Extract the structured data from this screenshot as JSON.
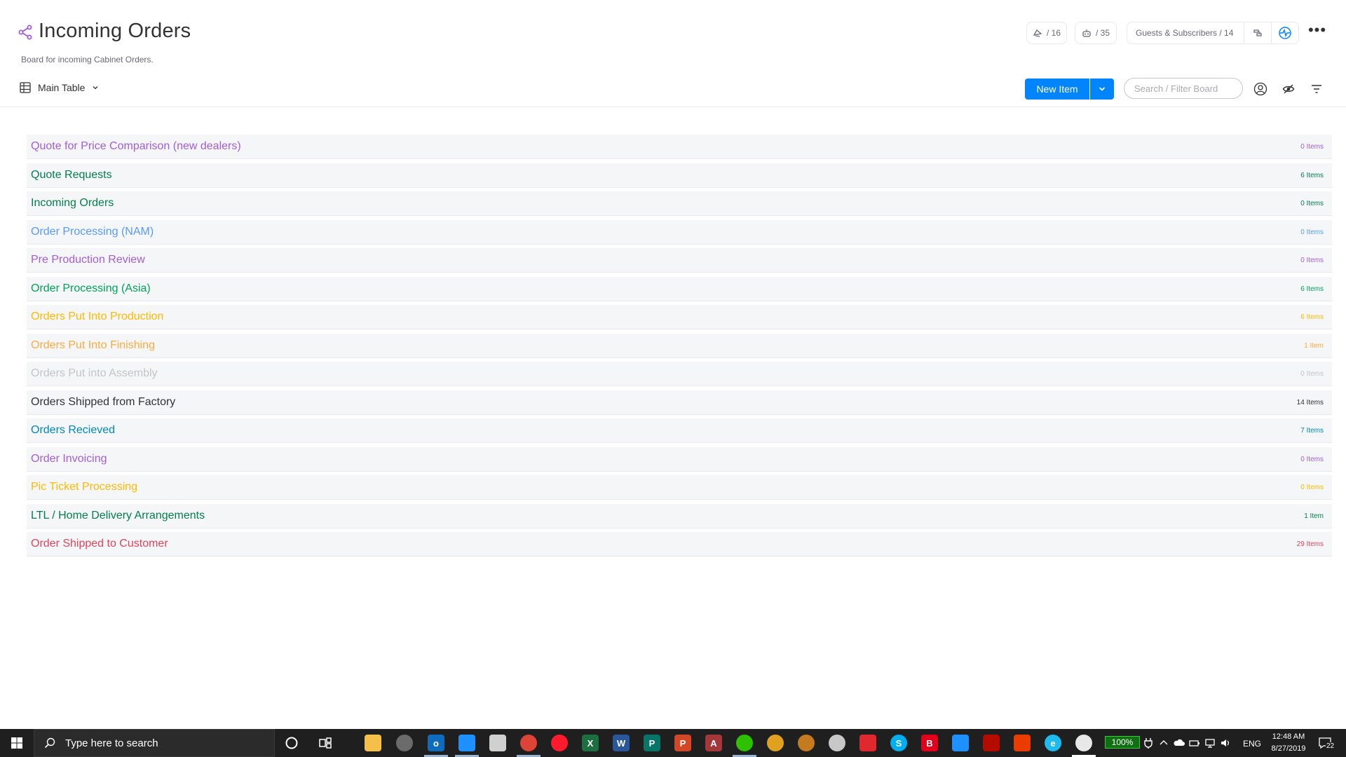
{
  "board": {
    "title": "Incoming Orders",
    "description": "Board for incoming Cabinet Orders.",
    "activity_count": "/ 16",
    "automations_count": "/ 35",
    "guests_label": "Guests & Subscribers / 14"
  },
  "toolbar": {
    "view_label": "Main Table",
    "new_item_label": "New Item",
    "search_placeholder": "Search / Filter Board"
  },
  "groups": [
    {
      "name": "Quote for Price Comparison (new dealers)",
      "count": "0 Items",
      "color": "#a25ddc"
    },
    {
      "name": "Quote Requests",
      "count": "6 Items",
      "color": "#037f4c"
    },
    {
      "name": "Incoming Orders",
      "count": "0 Items",
      "color": "#037f4c"
    },
    {
      "name": "Order Processing (NAM)",
      "count": "0 Items",
      "color": "#579bfc"
    },
    {
      "name": "Pre Production Review",
      "count": "0 Items",
      "color": "#a25ddc"
    },
    {
      "name": "Order Processing (Asia)",
      "count": "6 Items",
      "color": "#00a359"
    },
    {
      "name": "Orders Put Into Production",
      "count": "6 Items",
      "color": "#ffb900"
    },
    {
      "name": "Orders Put Into Finishing",
      "count": "1 Item",
      "color": "#fdab3d"
    },
    {
      "name": "Orders Put into Assembly",
      "count": "0 Items",
      "color": "#c4c4c4"
    },
    {
      "name": "Orders Shipped from Factory",
      "count": "14 Items",
      "color": "#323338"
    },
    {
      "name": "Orders Recieved",
      "count": "7 Items",
      "color": "#0086c0"
    },
    {
      "name": "Order Invoicing",
      "count": "0 Items",
      "color": "#a25ddc"
    },
    {
      "name": "Pic Ticket Processing",
      "count": "0 Items",
      "color": "#ffb900"
    },
    {
      "name": "LTL / Home Delivery Arrangements",
      "count": "1 Item",
      "color": "#037f4c"
    },
    {
      "name": "Order Shipped to Customer",
      "count": "29 Items",
      "color": "#e2445c"
    }
  ],
  "taskbar": {
    "search_placeholder": "Type here to search",
    "battery": "100%",
    "language": "ENG",
    "time": "12:48 AM",
    "date": "8/27/2019",
    "notifications": "22"
  },
  "icons": {
    "share": "share-icon",
    "view": "table-icon",
    "person": "person-icon",
    "eye": "eye-icon",
    "filter": "filter-icon"
  },
  "colors": {
    "primary": "#0085ff",
    "group_bg": "#f5f6f8",
    "taskbar": "#1f1f1f"
  }
}
